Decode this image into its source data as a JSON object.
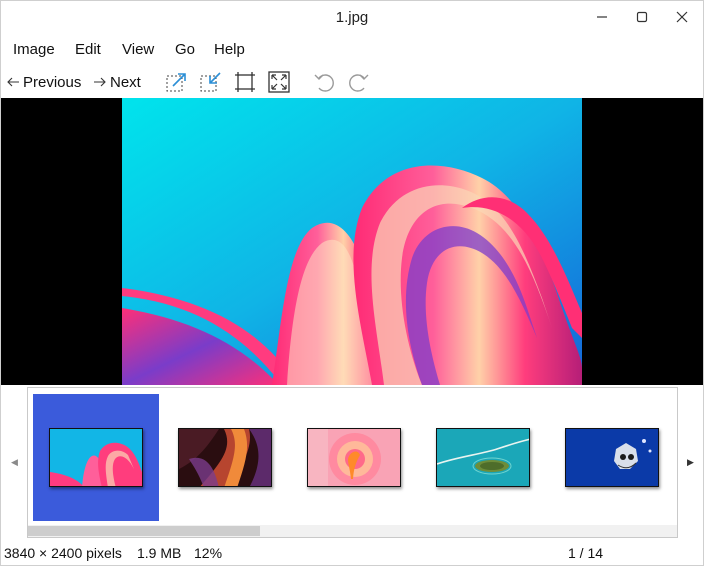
{
  "window": {
    "title": "1.jpg"
  },
  "menu": {
    "items": [
      "Image",
      "Edit",
      "View",
      "Go",
      "Help"
    ]
  },
  "toolbar": {
    "previous_label": "Previous",
    "next_label": "Next",
    "tools": [
      "zoom-in-icon",
      "zoom-out-icon",
      "fit-to-window-icon",
      "fullscreen-icon",
      "rotate-left-icon",
      "rotate-right-icon"
    ]
  },
  "thumbnails": {
    "count_visible": 5,
    "selected_index": 0,
    "items": [
      "abstract-ribbon-cyan",
      "canyon-purple",
      "abstract-pink-circle",
      "aerial-island-teal",
      "blue-graffiti"
    ]
  },
  "status": {
    "dimensions": "3840 × 2400 pixels",
    "filesize": "1.9 MB",
    "zoom": "12%",
    "position": "1 / 14"
  },
  "colors": {
    "selection": "#3b5bdb",
    "accent_cyan": "#00d9e8",
    "ribbon_pink": "#ff2f77"
  }
}
